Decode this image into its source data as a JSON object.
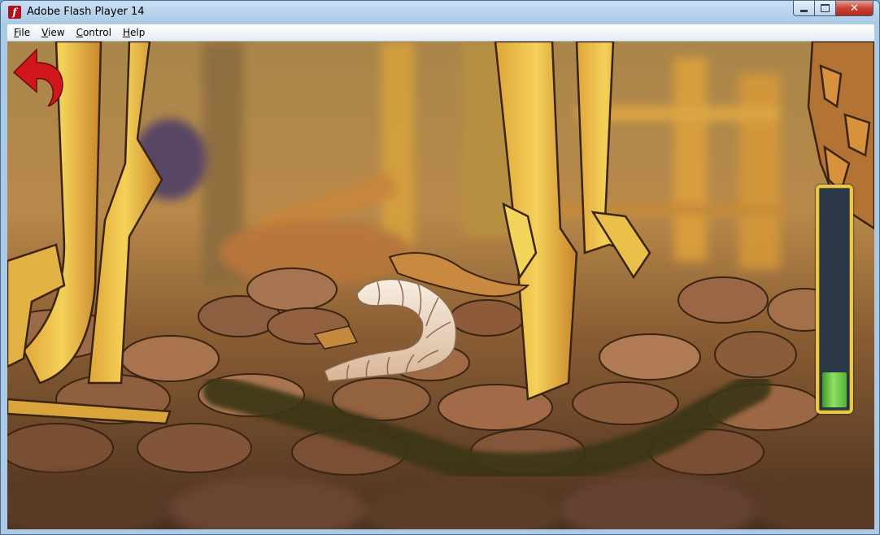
{
  "window": {
    "title": "Adobe Flash Player 14",
    "icon": "flash-player-icon",
    "controls": {
      "minimize": "minimize-icon",
      "maximize": "maximize-icon",
      "close": "✕"
    }
  },
  "menu": [
    {
      "label": "File",
      "accel": "F",
      "rest": "ile"
    },
    {
      "label": "View",
      "accel": "V",
      "rest": "iew"
    },
    {
      "label": "Control",
      "accel": "C",
      "rest": "ontrol"
    },
    {
      "label": "Help",
      "accel": "H",
      "rest": "elp"
    }
  ],
  "game": {
    "back_button_icon": "curved-back-arrow-icon",
    "back_button_color": "#d0171b",
    "energy_level": 0.16,
    "energy_color": "#5fc23c",
    "meter_border_color": "#e7c94a"
  }
}
